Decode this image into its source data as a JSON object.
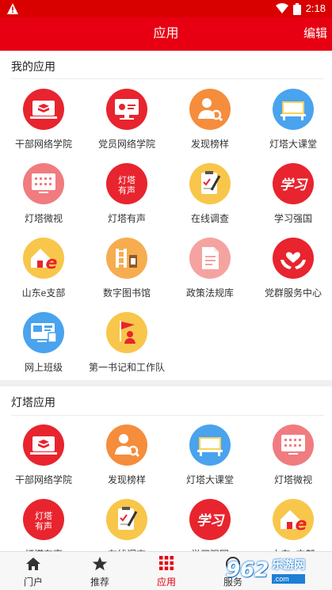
{
  "status": {
    "time": "2:18"
  },
  "header": {
    "title": "应用",
    "edit": "编辑"
  },
  "my_apps": {
    "title": "我的应用",
    "items": [
      {
        "label": "干部网络学院",
        "icon": "laptop-book-icon",
        "color": "#e8242e"
      },
      {
        "label": "党员网络学院",
        "icon": "monitor-party-icon",
        "color": "#e8242e"
      },
      {
        "label": "发现榜样",
        "icon": "person-search-icon",
        "color": "#f58d3c"
      },
      {
        "label": "灯塔大课堂",
        "icon": "classroom-board-icon",
        "color": "#4aa3ee"
      },
      {
        "label": "灯塔微视",
        "icon": "video-screen-icon",
        "color": "#f07c80"
      },
      {
        "label": "灯塔有声",
        "icon": "dengta-audio-icon",
        "color": "#e8242e"
      },
      {
        "label": "在线调查",
        "icon": "clipboard-pen-icon",
        "color": "#f8c64a"
      },
      {
        "label": "学习强国",
        "icon": "xuexi-icon",
        "color": "#e8242e"
      },
      {
        "label": "山东e支部",
        "icon": "house-e-icon",
        "color": "#f8c64a"
      },
      {
        "label": "数字图书馆",
        "icon": "library-shelf-icon",
        "color": "#f6ad4f"
      },
      {
        "label": "政策法规库",
        "icon": "document-icon",
        "color": "#f5a3a0"
      },
      {
        "label": "党群服务中心",
        "icon": "hands-heart-icon",
        "color": "#e8242e"
      },
      {
        "label": "网上班级",
        "icon": "online-class-icon",
        "color": "#4aa3ee"
      },
      {
        "label": "第一书记和工作队",
        "icon": "flag-person-icon",
        "color": "#f8c64a"
      }
    ]
  },
  "dengta_apps": {
    "title": "灯塔应用",
    "items": [
      {
        "label": "干部网络学院",
        "icon": "laptop-book-icon",
        "color": "#e8242e"
      },
      {
        "label": "发现榜样",
        "icon": "person-search-icon",
        "color": "#f58d3c"
      },
      {
        "label": "灯塔大课堂",
        "icon": "classroom-board-icon",
        "color": "#4aa3ee"
      },
      {
        "label": "灯塔微视",
        "icon": "video-screen-icon",
        "color": "#f07c80"
      },
      {
        "label": "灯塔有声",
        "icon": "dengta-audio-icon",
        "color": "#e8242e"
      },
      {
        "label": "在线调查",
        "icon": "clipboard-pen-icon",
        "color": "#f8c64a"
      },
      {
        "label": "学习强国",
        "icon": "xuexi-icon",
        "color": "#e8242e"
      },
      {
        "label": "山东e支部",
        "icon": "house-e-icon",
        "color": "#f8c64a"
      }
    ]
  },
  "bottom_nav": [
    {
      "label": "门户",
      "icon": "home-icon"
    },
    {
      "label": "推荐",
      "icon": "star-icon"
    },
    {
      "label": "应用",
      "icon": "grid-icon",
      "active": true
    },
    {
      "label": "服务",
      "icon": "service-icon"
    }
  ],
  "watermark": {
    "brand": "962",
    "site": "乐游网",
    "domain": ".com"
  }
}
